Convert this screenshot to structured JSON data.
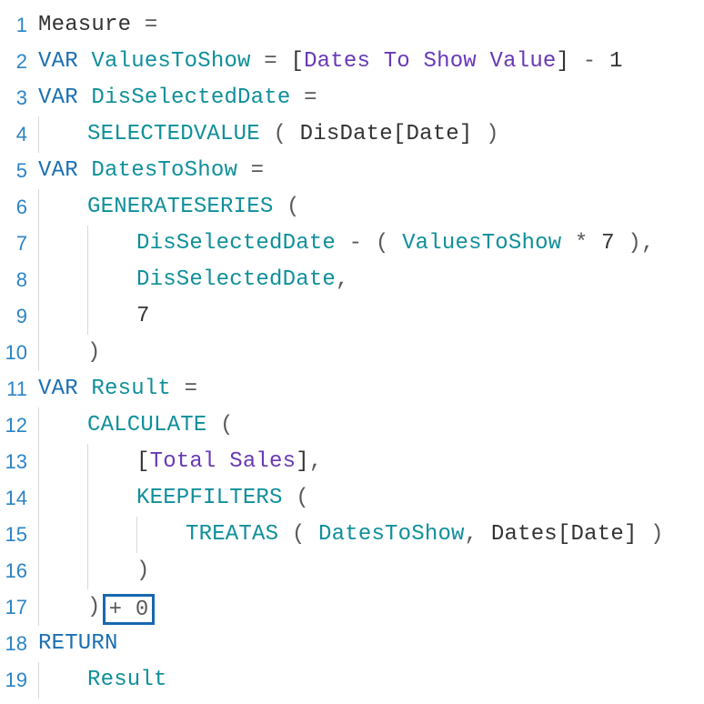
{
  "lines": {
    "l1": {
      "n": "1"
    },
    "l2": {
      "n": "2"
    },
    "l3": {
      "n": "3"
    },
    "l4": {
      "n": "4"
    },
    "l5": {
      "n": "5"
    },
    "l6": {
      "n": "6"
    },
    "l7": {
      "n": "7"
    },
    "l8": {
      "n": "8"
    },
    "l9": {
      "n": "9"
    },
    "l10": {
      "n": "10"
    },
    "l11": {
      "n": "11"
    },
    "l12": {
      "n": "12"
    },
    "l13": {
      "n": "13"
    },
    "l14": {
      "n": "14"
    },
    "l15": {
      "n": "15"
    },
    "l16": {
      "n": "16"
    },
    "l17": {
      "n": "17"
    },
    "l18": {
      "n": "18"
    },
    "l19": {
      "n": "19"
    }
  },
  "tokens": {
    "measure": "Measure",
    "eq": " = ",
    "eq_trail": " =",
    "var_kw": "VAR",
    "return_kw": "RETURN",
    "valuesToShow": "ValuesToShow",
    "datesToShowValue": "Dates To Show Value",
    "minus": " - ",
    "one": "1",
    "disSelectedDate": "DisSelectedDate",
    "selectedvalue": "SELECTEDVALUE",
    "sp_lpar_sp": " ( ",
    "sp_rpar": " )",
    "disDate": "DisDate",
    "lbr": "[",
    "rbr": "]",
    "dateCol": "Date",
    "datesToShow": "DatesToShow",
    "generateseries": "GENERATESERIES",
    "lpar": " (",
    "rpar": ")",
    "star": " * ",
    "seven": "7",
    "comma": ",",
    "comma_sp": ", ",
    "result": "Result",
    "calculate": "CALCULATE",
    "totalSales": "Total Sales",
    "keepfilters": "KEEPFILTERS",
    "treatas": "TREATAS",
    "datesTbl": "Dates",
    "plusZero": "+ 0",
    "lpar_sp": "( ",
    "rpar_comma": "),"
  }
}
